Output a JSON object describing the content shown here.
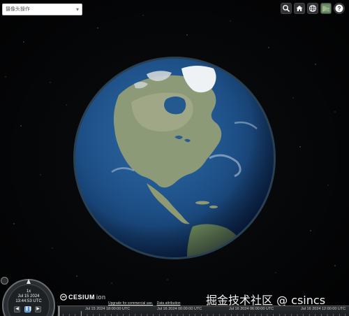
{
  "camera_control": {
    "placeholder": "摄像头操作"
  },
  "toolbar": {
    "buttons": [
      {
        "name": "search-button",
        "icon": "search-icon"
      },
      {
        "name": "home-button",
        "icon": "home-icon"
      },
      {
        "name": "scene-mode-button",
        "icon": "globe-icon"
      },
      {
        "name": "base-layer-picker-button",
        "icon": "map-layer-icon"
      },
      {
        "name": "help-button",
        "icon": "help-icon",
        "label": "?"
      }
    ]
  },
  "animation": {
    "speed": "1x",
    "date": "Jul 15 2024",
    "time": "13:44:53 UTC"
  },
  "credits": {
    "logo": "CESIUM",
    "logo_suffix": "ion",
    "upgrade_link": "Upgrade for commercial use.",
    "attribution_link": "Data attribution"
  },
  "watermark": "掘金技术社区 @ csincs",
  "timeline": {
    "labels": [
      "Jul 15 2024 18:00:00 UTC",
      "Jul 16 2024 00:00:00 UTC",
      "Jul 16 2024 06:00:00 UTC",
      "Jul 16 2024 12:00:00 UTC"
    ]
  },
  "colors": {
    "ocean": "#1d4f86",
    "land": "#8a9a7a",
    "toolbar_bg": "#303336",
    "accent": "#4a8ccf"
  }
}
